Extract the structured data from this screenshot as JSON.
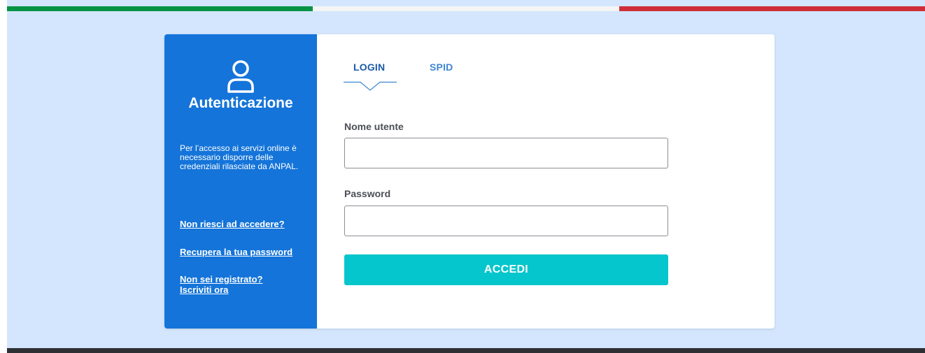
{
  "flag_colors": {
    "green": "#029344",
    "white": "#f5f5f5",
    "red": "#cf2e38"
  },
  "sidebar": {
    "icon": "user-icon",
    "title": "Autenticazione",
    "description": "Per l’accesso ai servizi online è necessario disporre delle credenziali rilasciate da ANPAL.",
    "links": [
      {
        "label": "Non riesci ad accedere?"
      },
      {
        "label": "Recupera la tua password"
      },
      {
        "label": "Non sei registrato? Iscriviti ora"
      }
    ],
    "color": "#1474d9"
  },
  "tabs": [
    {
      "label": "LOGIN",
      "active": true
    },
    {
      "label": "SPID",
      "active": false
    }
  ],
  "form": {
    "username_label": "Nome utente",
    "username_value": "",
    "password_label": "Password",
    "password_value": "",
    "submit_label": "ACCEDI",
    "submit_color": "#05c6cc"
  }
}
